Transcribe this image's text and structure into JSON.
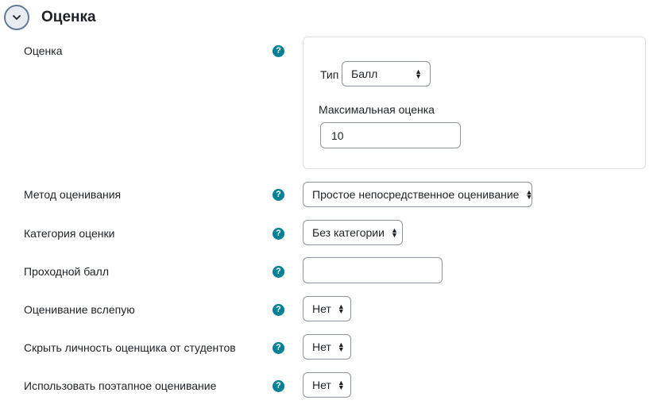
{
  "section": {
    "title": "Оценка"
  },
  "grade": {
    "label": "Оценка",
    "type_label": "Тип",
    "type_value": "Балл",
    "max_label": "Максимальная оценка",
    "max_value": "10"
  },
  "grading_method": {
    "label": "Метод оценивания",
    "value": "Простое непосредственное оценивание"
  },
  "grade_category": {
    "label": "Категория оценки",
    "value": "Без категории"
  },
  "pass_grade": {
    "label": "Проходной балл",
    "value": ""
  },
  "blind_marking": {
    "label": "Оценивание вслепую",
    "value": "Нет"
  },
  "hide_grader": {
    "label": "Скрыть личность оценщика от студентов",
    "value": "Нет"
  },
  "marking_workflow": {
    "label": "Использовать поэтапное оценивание",
    "value": "Нет"
  },
  "help_glyph": "?",
  "colors": {
    "help_icon": "#008196",
    "collapse_border": "#5f7d9a",
    "border": "#8f959e"
  },
  "icons": {
    "collapse": "chevron-down-icon",
    "help": "question-circle-icon",
    "select_caret": "sort-caret-icon"
  }
}
